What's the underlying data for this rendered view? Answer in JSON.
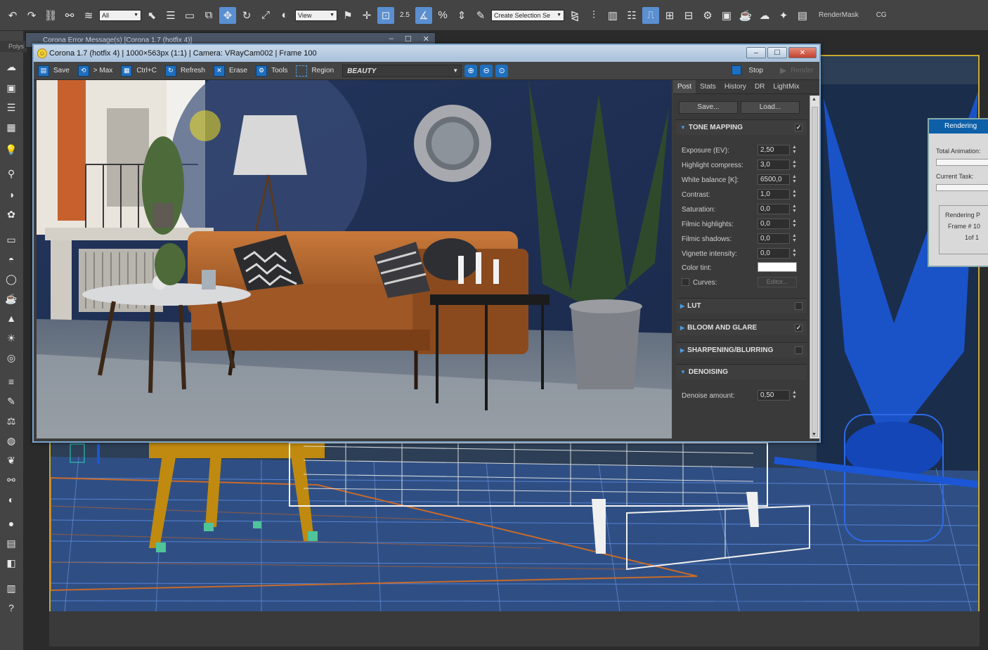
{
  "toolbar": {
    "selection_filter": "All",
    "view_dropdown": "View",
    "snap_label": "2.5",
    "named_selection_placeholder": "Create Selection Se",
    "render_mask": "RenderMask",
    "cg_label": "CG"
  },
  "left": {
    "poly_tab": "Polys"
  },
  "error_window": {
    "title": "Corona Error Message(s)   [Corona 1.7 (hotfix 4)]"
  },
  "vfb": {
    "title": "Corona 1.7 (hotfix 4) | 1000×563px (1:1) | Camera: VRayCam002 | Frame 100",
    "toolbar": {
      "save": "Save",
      "to_max": "> Max",
      "copy": "Ctrl+C",
      "refresh": "Refresh",
      "erase": "Erase",
      "tools": "Tools",
      "region": "Region",
      "channel": "BEAUTY",
      "stop": "Stop",
      "render": "Render"
    },
    "tabs": [
      "Post",
      "Stats",
      "History",
      "DR",
      "LightMix"
    ],
    "save_btn": "Save...",
    "load_btn": "Load...",
    "sections": {
      "tone_mapping": "TONE MAPPING",
      "lut": "LUT",
      "bloom": "BLOOM AND GLARE",
      "sharpening": "SHARPENING/BLURRING",
      "denoising": "DENOISING"
    },
    "params": [
      {
        "label": "Exposure (EV):",
        "value": "2,50"
      },
      {
        "label": "Highlight compress:",
        "value": "3,0"
      },
      {
        "label": "White balance [K]:",
        "value": "6500,0"
      },
      {
        "label": "Contrast:",
        "value": "1,0"
      },
      {
        "label": "Saturation:",
        "value": "0,0"
      },
      {
        "label": "Filmic highlights:",
        "value": "0,0"
      },
      {
        "label": "Filmic shadows:",
        "value": "0,0"
      },
      {
        "label": "Vignette intensity:",
        "value": "0,0"
      }
    ],
    "color_tint_label": "Color tint:",
    "color_tint": "#ffffff",
    "curves_label": "Curves:",
    "editor_btn": "Editor...",
    "denoise_label": "Denoise amount:",
    "denoise_value": "0,50"
  },
  "rendering_dialog": {
    "title": "Rendering",
    "total_animation": "Total Animation:",
    "current_task": "Current Task:",
    "rendering_progress": "Rendering P",
    "frame": "Frame # 10",
    "of": "1of 1"
  },
  "colors": {
    "accent": "#1f6fbf",
    "viewport_border": "#c8a830",
    "wire_blue": "#1b56d6",
    "chair_yellow": "#c08a10"
  }
}
